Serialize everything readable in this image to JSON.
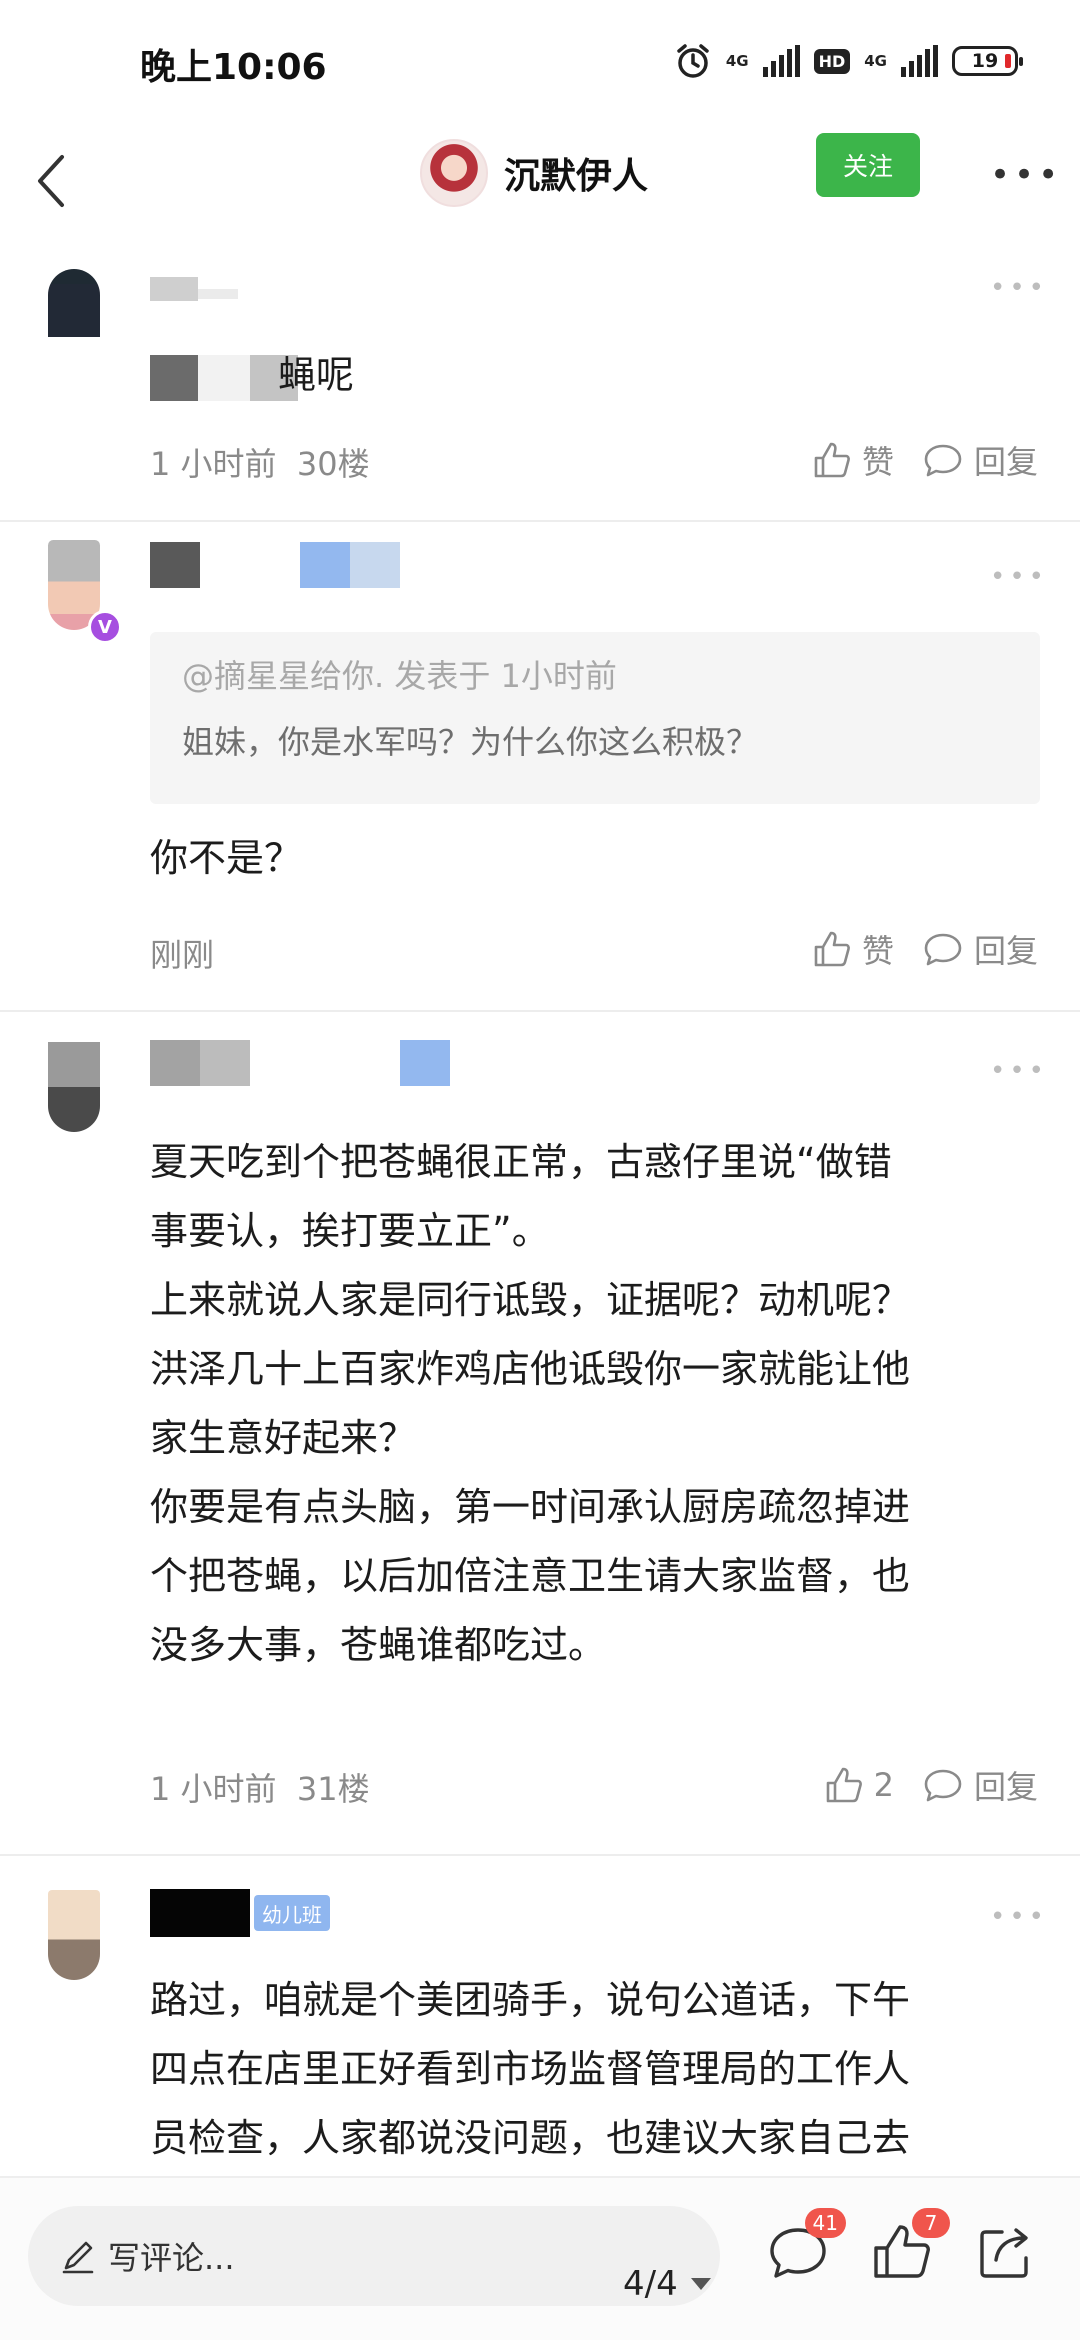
{
  "status_bar": {
    "time": "晚上10:06",
    "network_1": "4G",
    "network_2": "4G",
    "hd": "HD",
    "battery": "19"
  },
  "header": {
    "author_name": "沉默伊人",
    "follow_label": "关注"
  },
  "comments": [
    {
      "text": "蝇呢",
      "time": "1 小时前",
      "floor": "30楼",
      "like_label": "赞",
      "reply_label": "回复"
    },
    {
      "quote_head": "@摘星星给你. 发表于 1小时前",
      "quote_body": "姐妹，你是水军吗？为什么你这么积极？",
      "text": "你不是？",
      "time": "刚刚",
      "like_label": "赞",
      "reply_label": "回复"
    },
    {
      "lines": [
        "夏天吃到个把苍蝇很正常，古惑仔里说“做错",
        "事要认，挨打要立正”。",
        "上来就说人家是同行诋毁，证据呢？动机呢？",
        "洪泽几十上百家炸鸡店他诋毁你一家就能让他",
        "家生意好起来？",
        "你要是有点头脑，第一时间承认厨房疏忽掉进",
        "个把苍蝇，以后加倍注意卫生请大家监督，也",
        "没多大事，苍蝇谁都吃过。"
      ],
      "time": "1 小时前",
      "floor": "31楼",
      "like_count": "2",
      "reply_label": "回复"
    },
    {
      "badge": "幼儿班",
      "lines": [
        "路过，咱就是个美团骑手，说句公道话，下午",
        "四点在店里正好看到市场监督管理局的工作人",
        "员检查，人家都说没问题，也建议大家自己去"
      ]
    }
  ],
  "bottom_bar": {
    "comment_placeholder": "写评论...",
    "page_indicator": "4/4",
    "comment_count": "41",
    "like_count": "7"
  }
}
